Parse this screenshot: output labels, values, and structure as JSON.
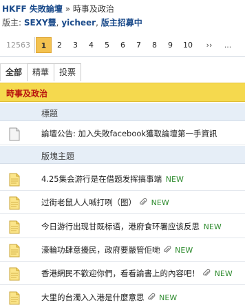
{
  "breadcrumb": {
    "forum": "HKFF 失敗論壇",
    "separator": "»",
    "current": "時事及政治"
  },
  "moderators": {
    "label": "版主:",
    "names": [
      "SEXY豐",
      "yicheer"
    ],
    "recruit": "版主招募中"
  },
  "pager": {
    "total": "12563",
    "pages": [
      "1",
      "2",
      "3",
      "4",
      "5",
      "6",
      "7",
      "8",
      "9",
      "10"
    ],
    "current": "1",
    "more": "››",
    "next": "..."
  },
  "tabs": [
    "全部",
    "精華",
    "投票"
  ],
  "section_title": "時事及政治",
  "headers": {
    "title": "標題",
    "board_topics": "版塊主題"
  },
  "announcement": {
    "title": "論壇公告: 加入失敗facebook獲取論壇第一手資訊"
  },
  "threads": [
    {
      "title": "4.25集会游行是在借题发挥搞事端",
      "attachment": false,
      "new": "NEW"
    },
    {
      "title": "过街老鼠人人喊打咧（图）",
      "attachment": true,
      "new": "NEW"
    },
    {
      "title": "今日游行出现甘既标语，港府食环署应该反思",
      "attachment": false,
      "new": "NEW"
    },
    {
      "title": "濠輪功肆意擾民，政府要嚴管佢哋",
      "attachment": true,
      "new": "NEW"
    },
    {
      "title": "香港網民不歡迎你們，看看論書上的內容吧！",
      "attachment": true,
      "new": "NEW"
    },
    {
      "title": "大里的台濁入入港是什麼意思",
      "attachment": true,
      "new": "NEW"
    }
  ],
  "colors": {
    "section_bg": "#f5d94e",
    "section_text": "#b8120e",
    "link": "#1a4a8a",
    "new": "#2e8b2e",
    "pager_active": "#f3c250"
  }
}
